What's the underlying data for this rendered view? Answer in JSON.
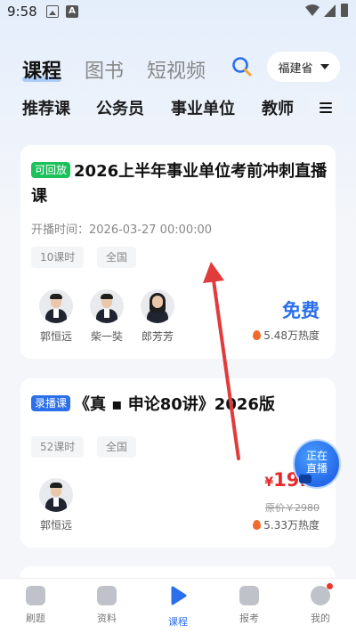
{
  "status_bar": {
    "time": "9:58"
  },
  "main_tabs": [
    {
      "label": "课程",
      "active": true
    },
    {
      "label": "图书",
      "active": false
    },
    {
      "label": "短视频",
      "active": false
    }
  ],
  "province": "福建省",
  "category_tabs": [
    "推荐课",
    "公务员",
    "事业单位",
    "教师"
  ],
  "courses": [
    {
      "badge": "可回放",
      "badge_color": "#1bc25b",
      "title": "2026上半年事业单位考前冲刺直播课",
      "start_time": "开播时间：2026-03-27 00:00:00",
      "tags": [
        "10课时",
        "全国"
      ],
      "teachers": [
        "郭恒远",
        "柴一奘",
        "郎芳芳"
      ],
      "price_label": "免费",
      "heat": "5.48万热度"
    },
    {
      "badge": "录播课",
      "badge_color": "#2b6fec",
      "title": "《真 ▪ 申论80讲》2026版",
      "tags": [
        "52课时",
        "全国"
      ],
      "teachers": [
        "郭恒远"
      ],
      "currency": "¥",
      "price": "19.9",
      "original_price": "原价￥2980",
      "heat": "5.33万热度"
    }
  ],
  "live_badge": {
    "line1": "正在",
    "line2": "直播"
  },
  "bottom_nav": [
    {
      "label": "刷题",
      "icon": "pencil-icon"
    },
    {
      "label": "资料",
      "icon": "document-icon"
    },
    {
      "label": "课程",
      "icon": "play-icon",
      "active": true
    },
    {
      "label": "报考",
      "icon": "star-icon"
    },
    {
      "label": "我的",
      "icon": "profile-icon"
    }
  ],
  "colors": {
    "accent": "#2b6fec",
    "price": "#e8292c",
    "replay": "#1bc25b"
  }
}
